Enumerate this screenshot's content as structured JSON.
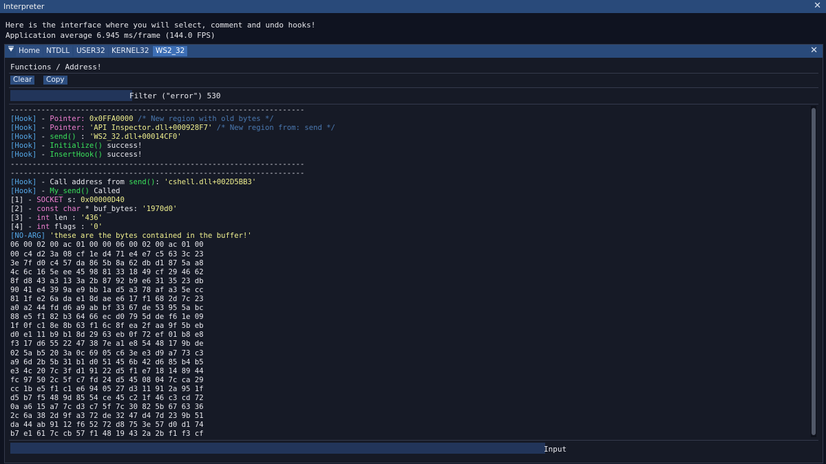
{
  "window": {
    "title": "Interpreter",
    "close_glyph": "✕"
  },
  "info": {
    "line1": "Here is the interface where you will select, comment and undo hooks!",
    "line2": "Application average 6.945 ms/frame (144.0 FPS)"
  },
  "tabs": {
    "items": [
      {
        "label": "Home"
      },
      {
        "label": "NTDLL"
      },
      {
        "label": "USER32"
      },
      {
        "label": "KERNEL32"
      },
      {
        "label": "WS2_32"
      }
    ],
    "active": "WS2_32",
    "close_glyph": "✕"
  },
  "breadcrumb": "Functions / Address!",
  "toolbar": {
    "clear_label": "Clear",
    "copy_label": "Copy"
  },
  "filter": {
    "value": "",
    "label": "Filter (\"error\") 530"
  },
  "log": [
    [
      [
        "-------------------------------------------------------------------",
        "dash"
      ]
    ],
    [
      [
        "[Hook]",
        "hook"
      ],
      [
        " - ",
        "white"
      ],
      [
        "Pointer: ",
        "ptr"
      ],
      [
        "0x0FFA0000",
        "str"
      ],
      [
        " /* New region with old bytes */",
        "comment"
      ]
    ],
    [
      [
        "[Hook]",
        "hook"
      ],
      [
        " - ",
        "white"
      ],
      [
        "Pointer: ",
        "ptr"
      ],
      [
        "'API Inspector.dll+000928F7'",
        "str"
      ],
      [
        " /* New region from: send */",
        "comment"
      ]
    ],
    [
      [
        "[Hook]",
        "hook"
      ],
      [
        " - ",
        "white"
      ],
      [
        "send()",
        "fn"
      ],
      [
        " : ",
        "white"
      ],
      [
        "'WS2_32.dll+00014CF0'",
        "str"
      ]
    ],
    [
      [
        "[Hook]",
        "hook"
      ],
      [
        " - ",
        "white"
      ],
      [
        "Initialize()",
        "fn"
      ],
      [
        " success!",
        "white"
      ]
    ],
    [
      [
        "[Hook]",
        "hook"
      ],
      [
        " - ",
        "white"
      ],
      [
        "InsertHook()",
        "fn"
      ],
      [
        " success!",
        "white"
      ]
    ],
    [
      [
        "-------------------------------------------------------------------",
        "dash"
      ]
    ],
    [
      [
        "-------------------------------------------------------------------",
        "dash"
      ]
    ],
    [
      [
        "[Hook]",
        "hook"
      ],
      [
        " - ",
        "white"
      ],
      [
        "Call address from ",
        "white"
      ],
      [
        "send()",
        "fn"
      ],
      [
        ": ",
        "white"
      ],
      [
        "'cshell.dll+002D5BB3'",
        "str"
      ]
    ],
    [
      [
        "[Hook]",
        "hook"
      ],
      [
        " - ",
        "white"
      ],
      [
        "My_send()",
        "fn"
      ],
      [
        " Called",
        "white"
      ]
    ],
    [
      [
        "[1] - ",
        "white"
      ],
      [
        "SOCKET",
        "kw"
      ],
      [
        " s: ",
        "white"
      ],
      [
        "0x00000D40",
        "str"
      ]
    ],
    [
      [
        "[2] - ",
        "white"
      ],
      [
        "const char",
        "kw"
      ],
      [
        " * buf_bytes: ",
        "white"
      ],
      [
        "'1970d0'",
        "str"
      ]
    ],
    [
      [
        "[3] - ",
        "white"
      ],
      [
        "int",
        "kw"
      ],
      [
        " len : ",
        "white"
      ],
      [
        "'436'",
        "str"
      ]
    ],
    [
      [
        "[4] - ",
        "white"
      ],
      [
        "int",
        "kw"
      ],
      [
        " flags : ",
        "white"
      ],
      [
        "'0'",
        "str"
      ]
    ],
    [
      [
        "[NO-ARG]",
        "hook"
      ],
      [
        " 'these are the bytes contained in the buffer!'",
        "str"
      ]
    ],
    [
      [
        "06 00 02 00 ac 01 00 00 06 00 02 00 ac 01 00",
        "white"
      ]
    ],
    [
      [
        "00 c4 d2 3a 08 cf 1e d4 71 e4 e7 c5 63 3c 23",
        "white"
      ]
    ],
    [
      [
        "3e 7f d0 c4 57 da 86 5b 8a 62 db d1 87 5a a8",
        "white"
      ]
    ],
    [
      [
        "4c 6c 16 5e ee 45 98 81 33 18 49 cf 29 46 62",
        "white"
      ]
    ],
    [
      [
        "8f d8 43 a3 13 3a 2b 87 92 b9 e6 31 35 23 db",
        "white"
      ]
    ],
    [
      [
        "90 41 e4 39 9a e9 bb 1a d5 a3 78 af a3 5e cc",
        "white"
      ]
    ],
    [
      [
        "81 1f e2 6a da e1 8d ae e6 17 f1 68 2d 7c 23",
        "white"
      ]
    ],
    [
      [
        "a0 a2 44 fd d6 a9 ab bf 33 67 de 53 95 5a bc",
        "white"
      ]
    ],
    [
      [
        "88 e5 f1 82 b3 64 66 ec d0 79 5d de f6 1e 09",
        "white"
      ]
    ],
    [
      [
        "1f 0f c1 8e 8b 63 f1 6c 8f ea 2f aa 9f 5b eb",
        "white"
      ]
    ],
    [
      [
        "d0 e1 11 b9 b1 8d 29 63 eb 0f 72 ef 01 b8 e8",
        "white"
      ]
    ],
    [
      [
        "f3 17 d6 55 22 47 38 7e a1 e8 54 48 17 9b de",
        "white"
      ]
    ],
    [
      [
        "02 5a b5 20 3a 0c 69 05 c6 3e e3 d9 a7 73 c3",
        "white"
      ]
    ],
    [
      [
        "a9 6d 2b 5b 31 b1 d0 51 45 6b 42 d6 85 b4 b5",
        "white"
      ]
    ],
    [
      [
        "e3 4c 20 7c 3f d1 91 22 d5 f1 e7 18 14 89 44",
        "white"
      ]
    ],
    [
      [
        "fc 97 50 2c 5f c7 fd 24 d5 45 08 04 7c ca 29",
        "white"
      ]
    ],
    [
      [
        "cc 1b e5 f1 c1 e6 94 05 27 d3 11 91 2a 95 1f",
        "white"
      ]
    ],
    [
      [
        "d5 b7 f5 48 9d 85 54 ce 45 c2 1f 46 c3 cd 72",
        "white"
      ]
    ],
    [
      [
        "0a a6 15 a7 7c d3 c7 5f 7c 30 82 5b 67 63 36",
        "white"
      ]
    ],
    [
      [
        "2c 6a 38 2d 9f a3 72 de 32 47 d4 7d 23 9b 51",
        "white"
      ]
    ],
    [
      [
        "da 44 ab 91 12 f6 52 72 d8 75 3e 57 d0 d1 74",
        "white"
      ]
    ],
    [
      [
        "b7 e1 61 7c cb 57 f1 48 19 43 2a 2b f1 f3 cf",
        "white"
      ]
    ]
  ],
  "input": {
    "value": "",
    "label": "Input"
  }
}
